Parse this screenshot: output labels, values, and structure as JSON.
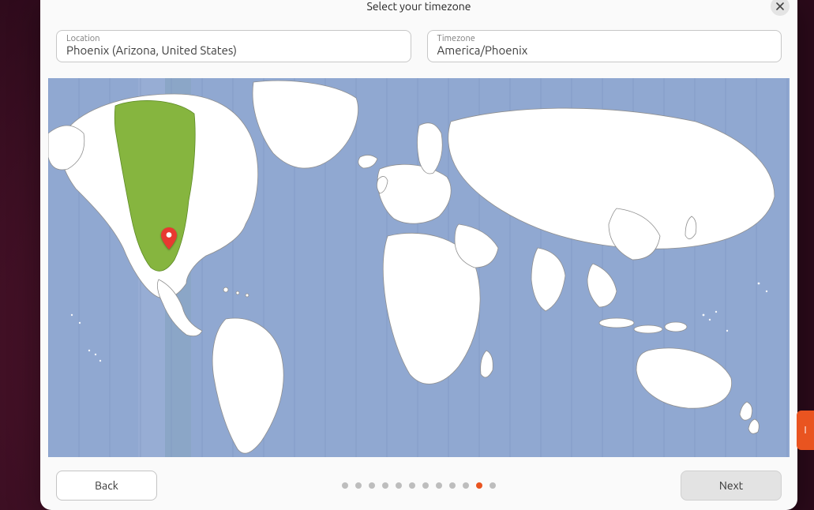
{
  "header": {
    "title": "Select your timezone",
    "close_label": "Close"
  },
  "fields": {
    "location": {
      "label": "Location",
      "value": "Phoenix (Arizona, United States)"
    },
    "timezone": {
      "label": "Timezone",
      "value": "America/Phoenix"
    }
  },
  "map": {
    "selected_highlight_color": "#86b53f",
    "marker_color": "#e83931",
    "ocean_color": "#90a8d1",
    "land_color": "#ffffff",
    "border_color": "#8f8f8f"
  },
  "footer": {
    "back_label": "Back",
    "next_label": "Next",
    "step_count": 12,
    "active_step_index": 10
  },
  "side_chip": {
    "text": "I"
  }
}
